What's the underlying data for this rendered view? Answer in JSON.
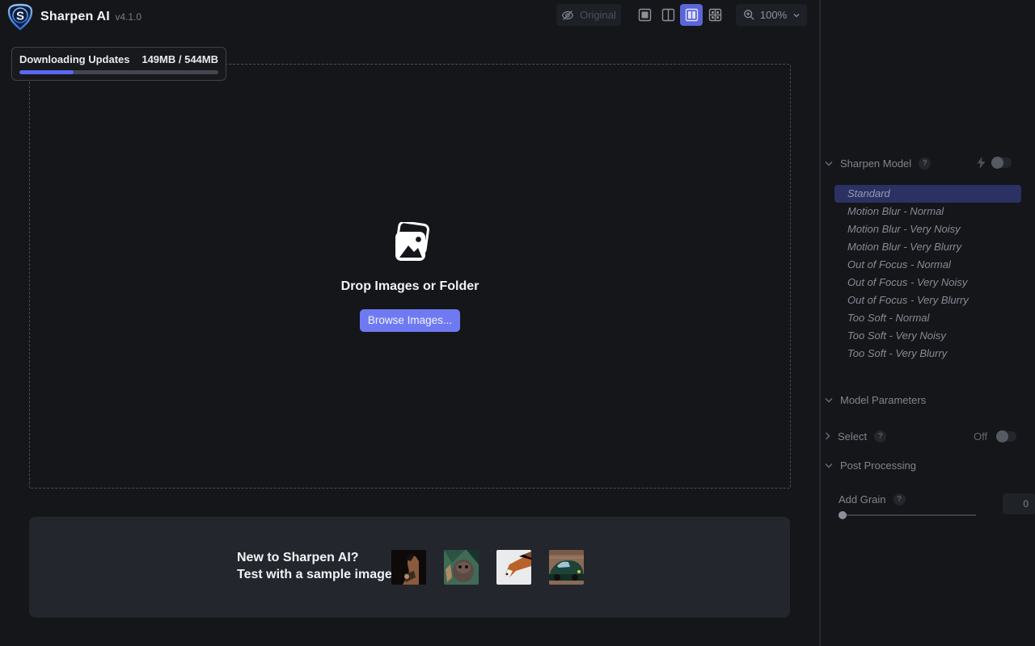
{
  "app": {
    "title": "Sharpen AI",
    "version": "v4.1.0"
  },
  "toolbar": {
    "original_label": "Original",
    "zoom_level": "100%",
    "view_modes": [
      "single-view",
      "split-view",
      "side-by-side-view",
      "quad-view"
    ],
    "selected_view_mode": "side-by-side-view"
  },
  "download": {
    "title": "Downloading Updates",
    "progress_text": "149MB / 544MB",
    "percent": 27.4
  },
  "dropzone": {
    "title": "Drop Images or Folder",
    "browse_label": "Browse Images..."
  },
  "samples": {
    "line1": "New to Sharpen AI?",
    "line2": "Test with a sample image",
    "thumbnails": [
      "portrait-woman",
      "owl",
      "fox-in-snow",
      "classic-green-car"
    ]
  },
  "sidebar": {
    "sharpen_model": {
      "label": "Sharpen Model",
      "auto_toggle_state": "off"
    },
    "models": [
      {
        "label": "Standard",
        "selected": true
      },
      {
        "label": "Motion Blur - Normal",
        "selected": false
      },
      {
        "label": "Motion Blur - Very Noisy",
        "selected": false
      },
      {
        "label": "Motion Blur - Very Blurry",
        "selected": false
      },
      {
        "label": "Out of Focus - Normal",
        "selected": false
      },
      {
        "label": "Out of Focus - Very Noisy",
        "selected": false
      },
      {
        "label": "Out of Focus - Very Blurry",
        "selected": false
      },
      {
        "label": "Too Soft - Normal",
        "selected": false
      },
      {
        "label": "Too Soft - Very Noisy",
        "selected": false
      },
      {
        "label": "Too Soft - Very Blurry",
        "selected": false
      }
    ],
    "model_parameters": {
      "label": "Model Parameters"
    },
    "select": {
      "label": "Select",
      "state": "Off"
    },
    "post_processing": {
      "label": "Post Processing"
    },
    "add_grain": {
      "label": "Add Grain",
      "value": "0"
    }
  },
  "colors": {
    "background": "#141619",
    "accent": "#6f7af2",
    "progress_fill": "#5b67f0",
    "selected_model_bg": "#2b3163",
    "selected_view_bg": "#5a66d8",
    "panel_bg": "#23262d"
  }
}
